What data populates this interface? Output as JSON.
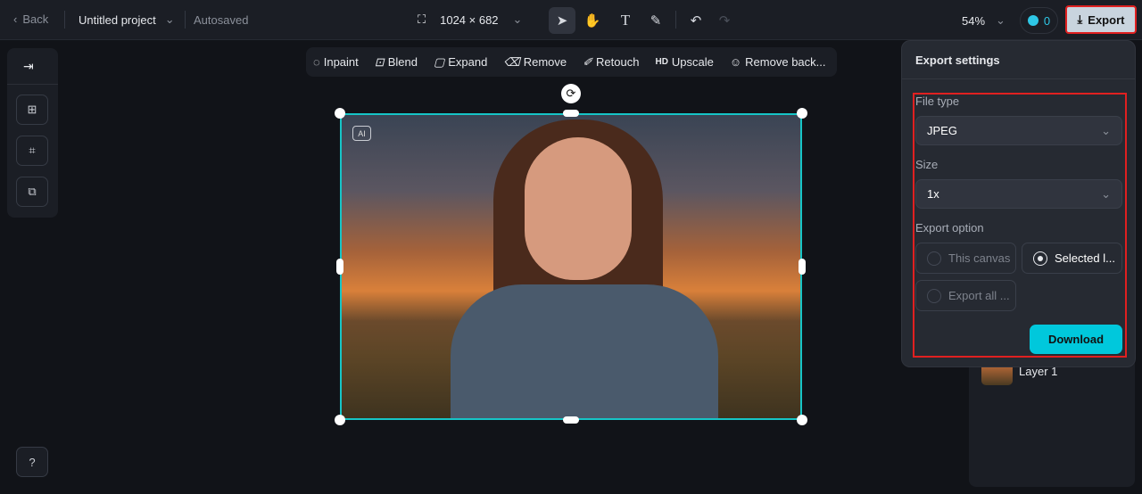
{
  "header": {
    "back": "Back",
    "project": "Untitled project",
    "status": "Autosaved",
    "dimensions": "1024 × 682",
    "zoom": "54%",
    "credits": "0",
    "export": "Export"
  },
  "toolbar": [
    "Inpaint",
    "Blend",
    "Expand",
    "Remove",
    "Retouch",
    "Upscale",
    "Remove back..."
  ],
  "upscale_badge": "HD",
  "canvas": {
    "ai_badge": "AI"
  },
  "layers": {
    "layer1": "Layer 1"
  },
  "export_panel": {
    "title": "Export settings",
    "file_type_label": "File type",
    "file_type": "JPEG",
    "size_label": "Size",
    "size": "1x",
    "option_label": "Export option",
    "options": [
      "This canvas",
      "Selected l...",
      "Export all ..."
    ],
    "selected_option": "Selected l...",
    "download": "Download"
  },
  "colors": {
    "accent": "#00c8dc",
    "selection": "#16c5c7",
    "highlight": "#e02020"
  }
}
